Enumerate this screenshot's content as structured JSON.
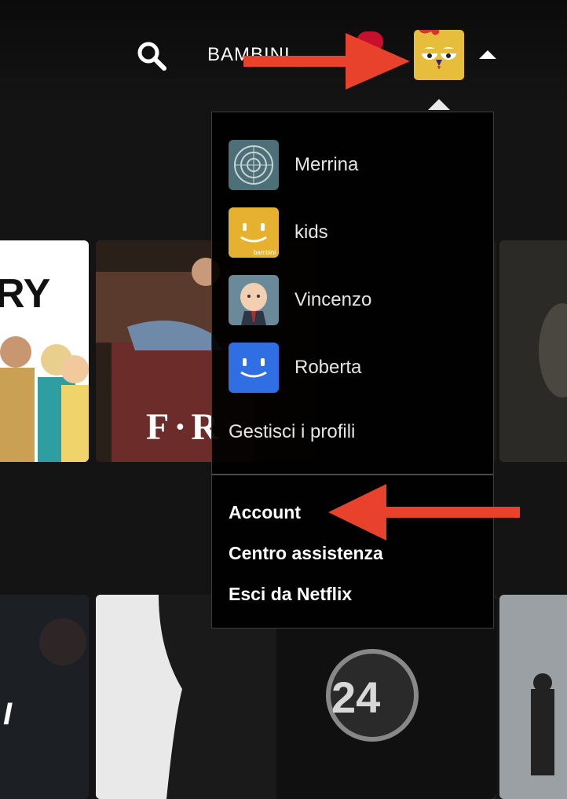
{
  "header": {
    "search_icon": "search-icon",
    "kids_label": "BAMBINI",
    "notification_icon": "bell-icon",
    "avatar_icon": "chicken-avatar-icon",
    "menu_caret": "caret-up-icon"
  },
  "dropdown": {
    "profiles": [
      {
        "name": "Merrina",
        "avatar": "mandala-avatar-icon"
      },
      {
        "name": "kids",
        "avatar": "kids-smile-avatar-icon",
        "avatar_caption": "bambini"
      },
      {
        "name": "Vincenzo",
        "avatar": "baby-boss-avatar-icon"
      },
      {
        "name": "Roberta",
        "avatar": "blue-smile-avatar-icon"
      }
    ],
    "manage_label": "Gestisci i profili",
    "links": [
      "Account",
      "Centro assistenza",
      "Esci da Netflix"
    ]
  },
  "rows": {
    "row1": {
      "tile1_title_fragment": "RY",
      "tile2_title_fragment": "F·R"
    },
    "row2": {
      "tile1_title_fragment": "I",
      "tile2_title_fragment": "24"
    }
  },
  "annotations": {
    "arrow_color": "#e8412c"
  },
  "colors": {
    "background": "#141414",
    "accent_red": "#c8102e",
    "menu_bg": "#000000"
  }
}
